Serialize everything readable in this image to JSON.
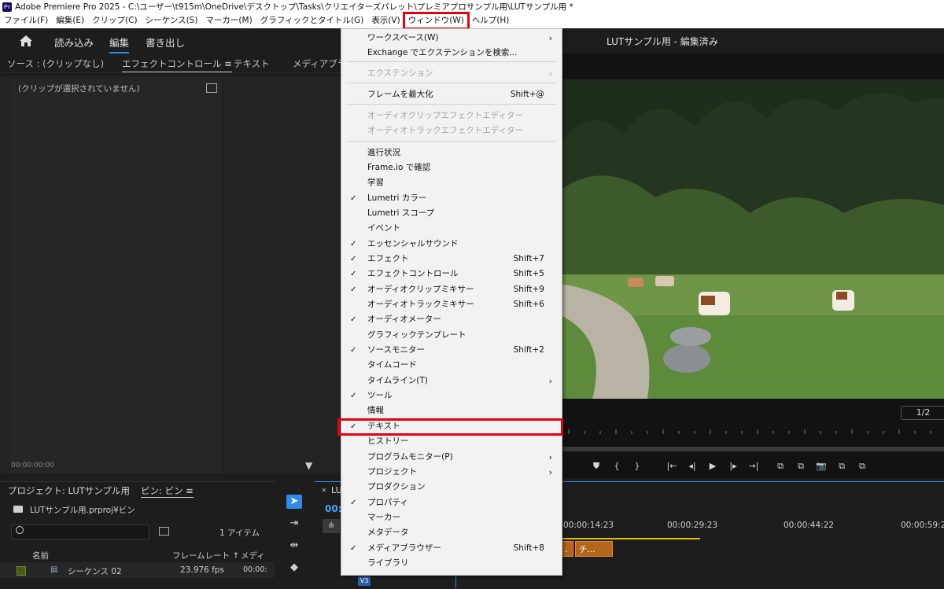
{
  "titlebar": {
    "logo": "Pr",
    "text": "Adobe Premiere Pro 2025 - C:\\ユーザー\\t915m\\OneDrive\\デスクトップ\\Tasks\\クリエイターズパレット\\プレミアプロサンプル用\\LUTサンプル用 *"
  },
  "menubar": [
    "ファイル(F)",
    "編集(E)",
    "クリップ(C)",
    "シーケンス(S)",
    "マーカー(M)",
    "グラフィックとタイトル(G)",
    "表示(V)",
    "ウィンドウ(W)",
    "ヘルプ(H)"
  ],
  "workspace": {
    "tabs": [
      "読み込み",
      "編集",
      "書き出し"
    ],
    "project_title": "LUTサンプル用 - 編集済み"
  },
  "source_tabs": [
    "ソース : (クリップなし)",
    "エフェクトコントロール ≡",
    "テキスト",
    "メディアブラウ"
  ],
  "effect_controls": {
    "empty_message": "(クリップが選択されていません)",
    "timecode": "00:00:00:00"
  },
  "program": {
    "resolution": "1/2"
  },
  "transport": [
    "⛊",
    "{",
    "}",
    "|←",
    "◂|",
    "▶",
    "|▸",
    "→|",
    "⧉",
    "⧉",
    "📷",
    "⧉",
    "⧉"
  ],
  "project": {
    "tab": "プロジェクト: LUTサンプル用",
    "bin_tab": "ビン: ビン ≡",
    "file": "LUTサンプル用.prproj¥ビン",
    "count": "1 アイテム",
    "columns": {
      "name": "名前",
      "fps": "フレームレート ↑",
      "media": "メディ"
    },
    "rows": [
      {
        "name": "シーケンス 02",
        "fps": "23.976 fps",
        "media": "00:00:"
      }
    ]
  },
  "timeline": {
    "name": "LU",
    "timecode": "00:",
    "markers": [
      "00:00:14:23",
      "00:00:29:23",
      "00:00:44:22",
      "00:00:59:2"
    ],
    "clips": [
      ".",
      "チ..."
    ],
    "track": "V3"
  },
  "window_menu": {
    "items": [
      {
        "label": "ワークスペース(W)",
        "check": false,
        "shortcut": "",
        "submenu": true,
        "disabled": false
      },
      {
        "label": "Exchange でエクステンションを検索...",
        "check": false,
        "shortcut": "",
        "submenu": false,
        "disabled": false
      },
      {
        "label": "エクステンション",
        "check": false,
        "shortcut": "",
        "submenu": true,
        "disabled": true
      },
      {
        "label": "フレームを最大化",
        "check": false,
        "shortcut": "Shift+@",
        "submenu": false,
        "disabled": false
      },
      {
        "label": "オーディオクリップエフェクトエディター",
        "check": false,
        "shortcut": "",
        "submenu": false,
        "disabled": true
      },
      {
        "label": "オーディオトラックエフェクトエディター",
        "check": false,
        "shortcut": "",
        "submenu": false,
        "disabled": true
      },
      {
        "label": "進行状況",
        "check": false,
        "shortcut": "",
        "submenu": false,
        "disabled": false
      },
      {
        "label": "Frame.io で確認",
        "check": false,
        "shortcut": "",
        "submenu": false,
        "disabled": false
      },
      {
        "label": "学習",
        "check": false,
        "shortcut": "",
        "submenu": false,
        "disabled": false
      },
      {
        "label": "Lumetri カラー",
        "check": true,
        "shortcut": "",
        "submenu": false,
        "disabled": false
      },
      {
        "label": "Lumetri スコープ",
        "check": false,
        "shortcut": "",
        "submenu": false,
        "disabled": false
      },
      {
        "label": "イベント",
        "check": false,
        "shortcut": "",
        "submenu": false,
        "disabled": false
      },
      {
        "label": "エッセンシャルサウンド",
        "check": true,
        "shortcut": "",
        "submenu": false,
        "disabled": false
      },
      {
        "label": "エフェクト",
        "check": true,
        "shortcut": "Shift+7",
        "submenu": false,
        "disabled": false
      },
      {
        "label": "エフェクトコントロール",
        "check": true,
        "shortcut": "Shift+5",
        "submenu": false,
        "disabled": false
      },
      {
        "label": "オーディオクリップミキサー",
        "check": true,
        "shortcut": "Shift+9",
        "submenu": false,
        "disabled": false
      },
      {
        "label": "オーディオトラックミキサー",
        "check": false,
        "shortcut": "Shift+6",
        "submenu": false,
        "disabled": false
      },
      {
        "label": "オーディオメーター",
        "check": true,
        "shortcut": "",
        "submenu": false,
        "disabled": false
      },
      {
        "label": "グラフィックテンプレート",
        "check": false,
        "shortcut": "",
        "submenu": false,
        "disabled": false
      },
      {
        "label": "ソースモニター",
        "check": true,
        "shortcut": "Shift+2",
        "submenu": false,
        "disabled": false
      },
      {
        "label": "タイムコード",
        "check": false,
        "shortcut": "",
        "submenu": false,
        "disabled": false
      },
      {
        "label": "タイムライン(T)",
        "check": false,
        "shortcut": "",
        "submenu": true,
        "disabled": false
      },
      {
        "label": "ツール",
        "check": true,
        "shortcut": "",
        "submenu": false,
        "disabled": false
      },
      {
        "label": "情報",
        "check": false,
        "shortcut": "",
        "submenu": false,
        "disabled": false
      },
      {
        "label": "テキスト",
        "check": true,
        "shortcut": "",
        "submenu": false,
        "disabled": false
      },
      {
        "label": "ヒストリー",
        "check": false,
        "shortcut": "",
        "submenu": false,
        "disabled": false
      },
      {
        "label": "プログラムモニター(P)",
        "check": false,
        "shortcut": "",
        "submenu": true,
        "disabled": false
      },
      {
        "label": "プロジェクト",
        "check": false,
        "shortcut": "",
        "submenu": true,
        "disabled": false
      },
      {
        "label": "プロダクション",
        "check": false,
        "shortcut": "",
        "submenu": false,
        "disabled": false
      },
      {
        "label": "プロパティ",
        "check": true,
        "shortcut": "",
        "submenu": false,
        "disabled": false
      },
      {
        "label": "マーカー",
        "check": false,
        "shortcut": "",
        "submenu": false,
        "disabled": false
      },
      {
        "label": "メタデータ",
        "check": false,
        "shortcut": "",
        "submenu": false,
        "disabled": false
      },
      {
        "label": "メディアブラウザー",
        "check": true,
        "shortcut": "Shift+8",
        "submenu": false,
        "disabled": false
      },
      {
        "label": "ライブラリ",
        "check": false,
        "shortcut": "",
        "submenu": false,
        "disabled": false
      }
    ]
  }
}
